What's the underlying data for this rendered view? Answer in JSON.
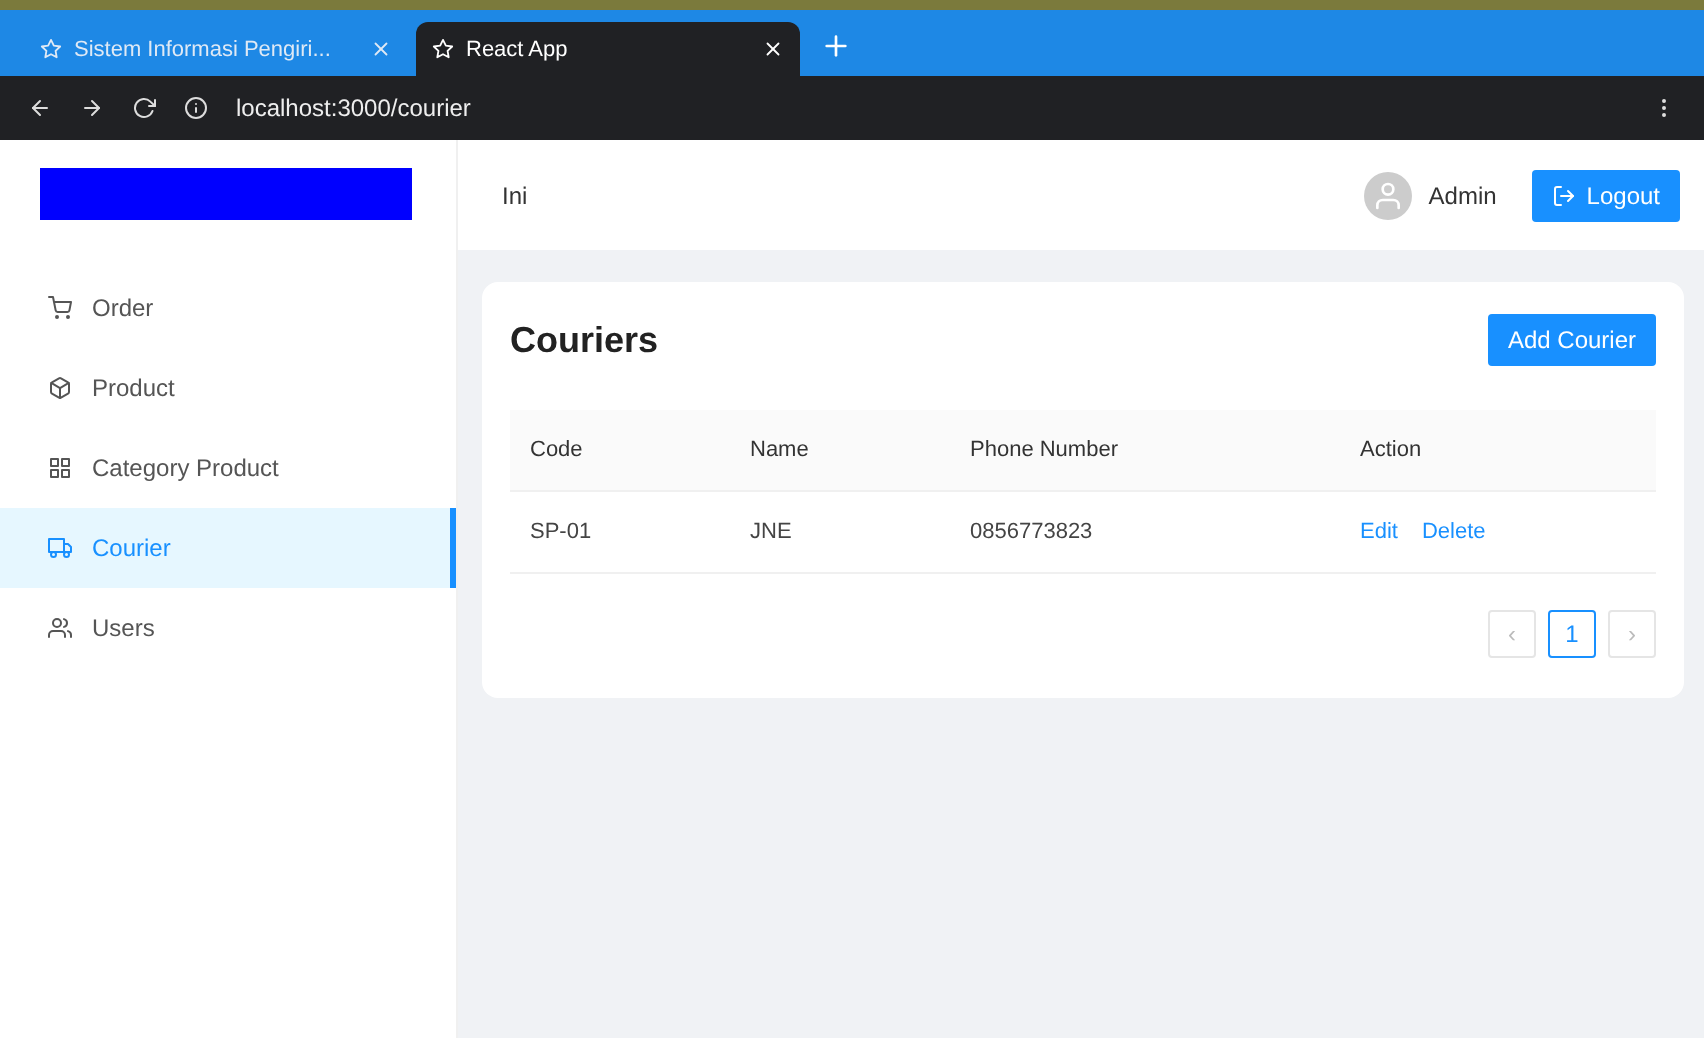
{
  "browser": {
    "tabs": [
      {
        "title": "Sistem Informasi Pengiri...",
        "selected": false
      },
      {
        "title": "React App",
        "selected": true
      }
    ],
    "url": "localhost:3000/courier"
  },
  "sidebar": {
    "items": [
      {
        "label": "Order",
        "selected": false
      },
      {
        "label": "Product",
        "selected": false
      },
      {
        "label": "Category Product",
        "selected": false
      },
      {
        "label": "Courier",
        "selected": true
      },
      {
        "label": "Users",
        "selected": false
      }
    ]
  },
  "header": {
    "title": "Ini",
    "user": "Admin",
    "logout": "Logout"
  },
  "page": {
    "title": "Couriers",
    "add_button": "Add Courier",
    "table": {
      "columns": [
        "Code",
        "Name",
        "Phone Number",
        "Action"
      ],
      "rows": [
        {
          "cells": [
            "SP-01",
            "JNE",
            "0856773823"
          ],
          "actions": [
            "Edit",
            "Delete"
          ]
        }
      ]
    },
    "pagination": {
      "prev": "‹",
      "next": "›",
      "pages": [
        {
          "label": "1",
          "selected": true
        }
      ]
    }
  }
}
